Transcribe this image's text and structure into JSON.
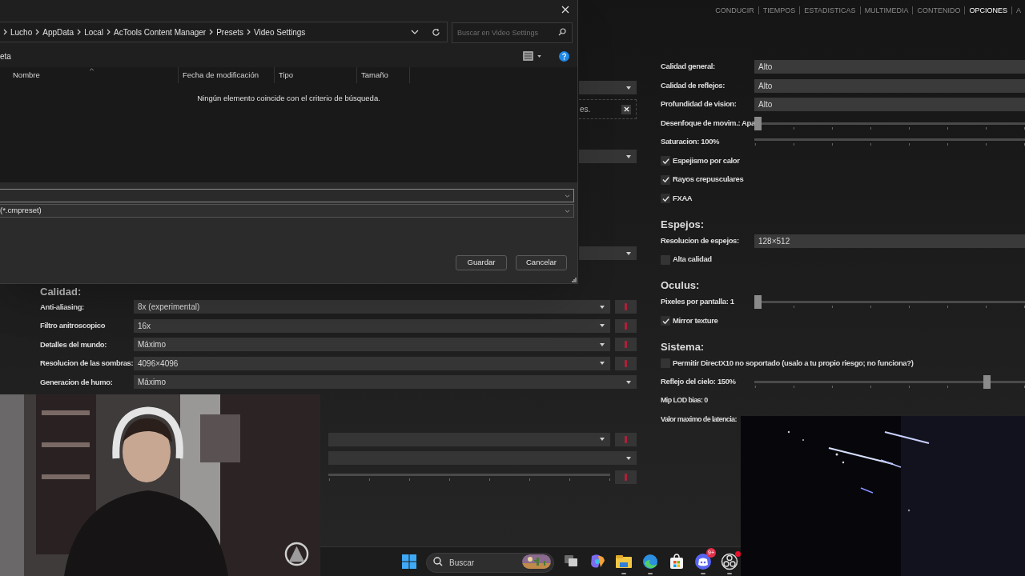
{
  "app": {
    "nav": [
      {
        "label": "CONDUCIR",
        "selected": false
      },
      {
        "label": "TIEMPOS",
        "selected": false
      },
      {
        "label": "ESTADISTICAS",
        "selected": false
      },
      {
        "label": "MULTIMEDIA",
        "selected": false
      },
      {
        "label": "CONTENIDO",
        "selected": false
      },
      {
        "label": "OPCIONES",
        "selected": true
      },
      {
        "label": "A",
        "selected": false
      }
    ],
    "left_panel": {
      "upper_rows": [
        {
          "kind": "dropdown"
        },
        {
          "kind": "notice",
          "text": "es."
        },
        {
          "kind": "dropdown"
        },
        {
          "kind": "dropdown"
        }
      ],
      "heading": "Calidad:",
      "rows": [
        {
          "label": "Anti-aliasing:",
          "value": "8x (experimental)",
          "reset": true
        },
        {
          "label": "Filtro anitroscopico",
          "value": "16x",
          "reset": true
        },
        {
          "label": "Detalles del mundo:",
          "value": "Máximo",
          "reset": true
        },
        {
          "label": "Resolucion de las sombras:",
          "value": "4096×4096",
          "reset": true
        },
        {
          "label": "Generacion de humo:",
          "value": "Máximo",
          "reset": false
        }
      ],
      "lower_rows": [
        {
          "kind": "dropdown",
          "reset": true
        },
        {
          "kind": "dropdown",
          "reset": false
        },
        {
          "kind": "track",
          "reset": true
        }
      ]
    },
    "right_panel": [
      {
        "rows": [
          {
            "kind": "select",
            "label": "Calidad general:",
            "value": "Alto"
          },
          {
            "kind": "select",
            "label": "Calidad de reflejos:",
            "value": "Alto"
          },
          {
            "kind": "select",
            "label": "Profundidad de vision:",
            "value": "Alto"
          },
          {
            "kind": "slider",
            "label": "Desenfoque de movim.: Apa",
            "level": 0
          },
          {
            "kind": "track",
            "label": "Saturacion: 100%"
          },
          {
            "kind": "checkbox",
            "label": "Espejismo por calor",
            "checked": true
          },
          {
            "kind": "checkbox",
            "label": "Rayos crepusculares",
            "checked": true
          },
          {
            "kind": "checkbox",
            "label": "FXAA",
            "checked": true
          }
        ]
      },
      {
        "heading": "Espejos:",
        "rows": [
          {
            "kind": "select",
            "label": "Resolucion de espejos:",
            "value": "128×512"
          },
          {
            "kind": "checkbox",
            "label": "Alta calidad",
            "checked": false
          }
        ]
      },
      {
        "heading": "Oculus:",
        "rows": [
          {
            "kind": "slider",
            "label": "Pixeles por pantalla: 1",
            "level": 0
          },
          {
            "kind": "checkbox",
            "label": "Mirror texture",
            "checked": true
          }
        ]
      },
      {
        "heading": "Sistema:",
        "rows": [
          {
            "kind": "checkbox",
            "label": "Permitir DirectX10 no soportado (usalo a tu propio riesgo; no funciona?)",
            "checked": false
          },
          {
            "kind": "slider",
            "label": "Reflejo del cielo: 150%",
            "level": 0.87
          },
          {
            "kind": "text",
            "label": "Mip LOD bias: 0"
          },
          {
            "kind": "text",
            "label": "Valor maximo de latencia:"
          }
        ]
      }
    ]
  },
  "dialog": {
    "breadcrumb": [
      "Lucho",
      "AppData",
      "Local",
      "AcTools Content Manager",
      "Presets",
      "Video Settings"
    ],
    "search": {
      "placeholder": "Buscar en Video Settings"
    },
    "toolbar_label": "eta",
    "columns": [
      {
        "label": "Nombre",
        "sorted": true
      },
      {
        "label": "Fecha de modificación",
        "sorted": false
      },
      {
        "label": "Tipo",
        "sorted": false
      },
      {
        "label": "Tamaño",
        "sorted": false
      }
    ],
    "empty_message": "Ningún elemento coincide con el criterio de búsqueda.",
    "file_type": "(*.cmpreset)",
    "buttons": [
      "Guardar",
      "Cancelar"
    ]
  },
  "taskbar": {
    "search": {
      "placeholder": "Buscar"
    },
    "apps": [
      {
        "kind": "task-view",
        "running": false
      },
      {
        "kind": "copilot",
        "running": false
      },
      {
        "kind": "files",
        "running": true
      },
      {
        "kind": "edge",
        "running": true
      },
      {
        "kind": "store",
        "running": false
      },
      {
        "kind": "discord",
        "running": true,
        "badge": "9+"
      },
      {
        "kind": "obs",
        "running": true,
        "alert": true
      }
    ]
  }
}
